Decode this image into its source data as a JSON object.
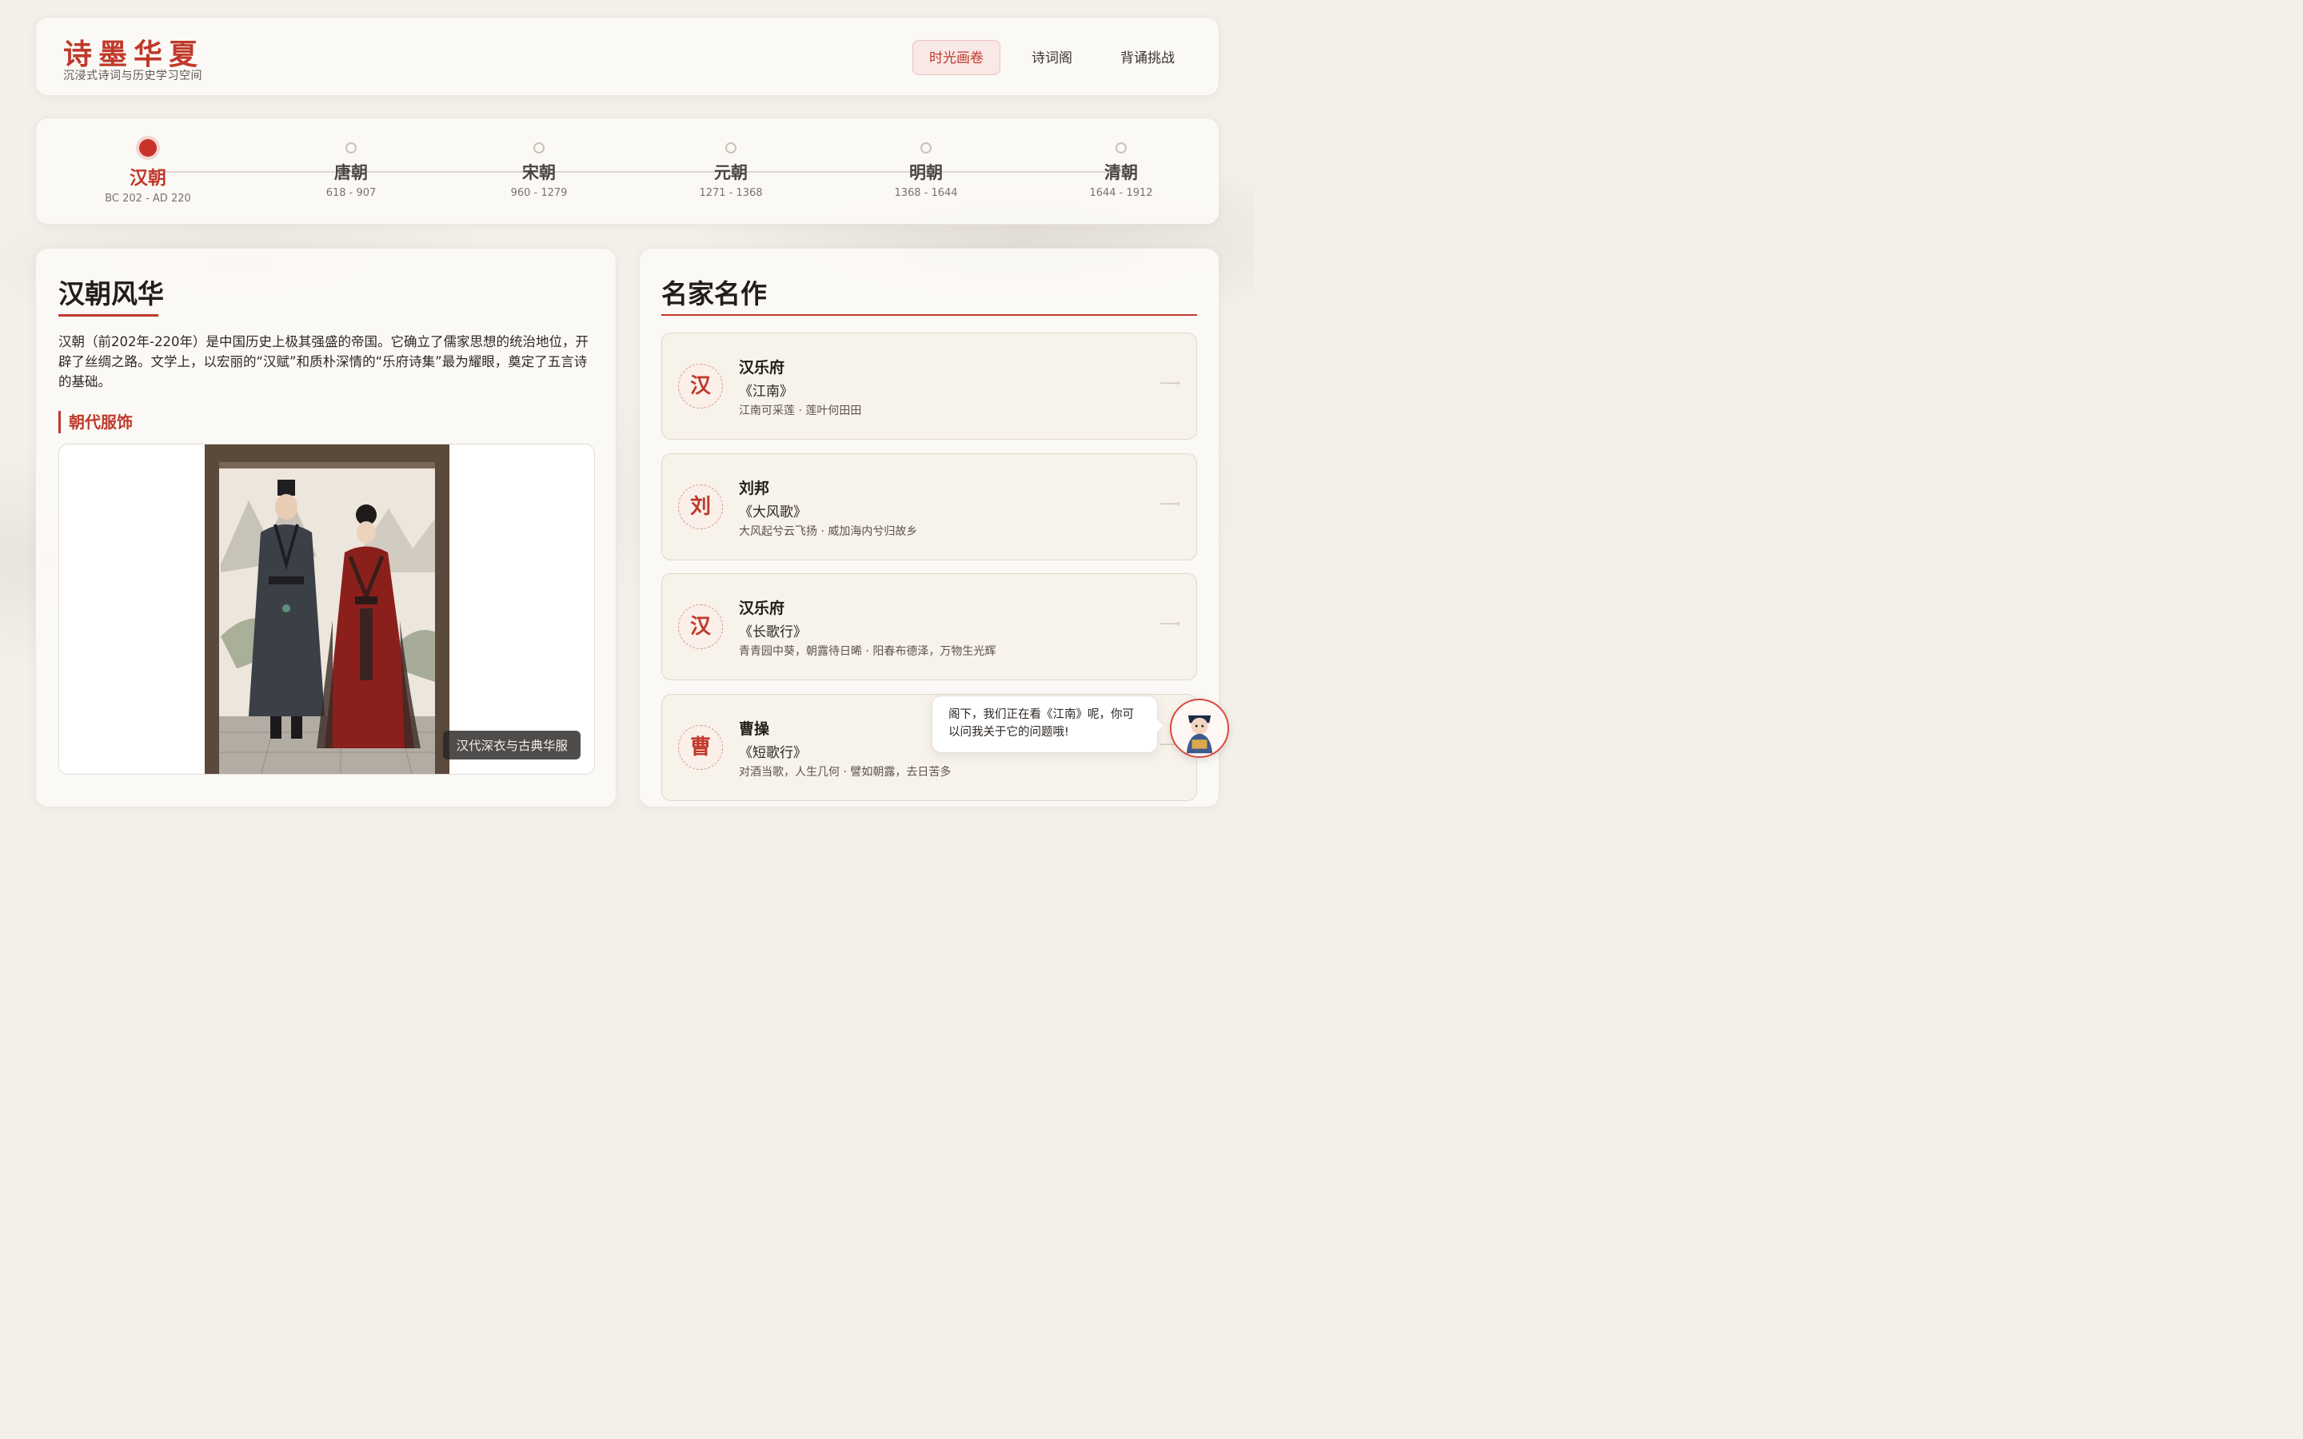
{
  "header": {
    "logo": "诗墨华夏",
    "subtitle": "沉浸式诗词与历史学习空间",
    "nav": [
      {
        "label": "时光画卷",
        "active": true
      },
      {
        "label": "诗词阁",
        "active": false
      },
      {
        "label": "背诵挑战",
        "active": false
      }
    ]
  },
  "timeline": {
    "eras": [
      {
        "name": "汉朝",
        "years": "BC 202 - AD 220",
        "active": true
      },
      {
        "name": "唐朝",
        "years": "618 - 907",
        "active": false
      },
      {
        "name": "宋朝",
        "years": "960 - 1279",
        "active": false
      },
      {
        "name": "元朝",
        "years": "1271 - 1368",
        "active": false
      },
      {
        "name": "明朝",
        "years": "1368 - 1644",
        "active": false
      },
      {
        "name": "清朝",
        "years": "1644 - 1912",
        "active": false
      }
    ]
  },
  "dynasty": {
    "title": "汉朝风华",
    "intro": "汉朝（前202年-220年）是中国历史上极其强盛的帝国。它确立了儒家思想的统治地位，开辟了丝绸之路。文学上，以宏丽的“汉赋”和质朴深情的“乐府诗集”最为耀眼，奠定了五言诗的基础。",
    "costume_heading": "朝代服饰",
    "costume_caption": "汉代深衣与古典华服"
  },
  "works": {
    "title": "名家名作",
    "items": [
      {
        "seal": "汉",
        "author": "汉乐府",
        "title": "《江南》",
        "lines": "江南可采莲 · 莲叶何田田"
      },
      {
        "seal": "刘",
        "author": "刘邦",
        "title": "《大风歌》",
        "lines": "大风起兮云飞扬 · 威加海内兮归故乡"
      },
      {
        "seal": "汉",
        "author": "汉乐府",
        "title": "《长歌行》",
        "lines": "青青园中葵，朝露待日晞 · 阳春布德泽，万物生光辉"
      },
      {
        "seal": "曹",
        "author": "曹操",
        "title": "《短歌行》",
        "lines": "对酒当歌，人生几何 · 譬如朝露，去日苦多"
      }
    ],
    "arrow": "⟶"
  },
  "assistant": {
    "message": "阁下，我们正在看《江南》呢，你可以问我关于它的问题哦!"
  },
  "colors": {
    "accent": "#c0392b",
    "background": "#f3f0ea",
    "card": "#fbf9f6"
  }
}
